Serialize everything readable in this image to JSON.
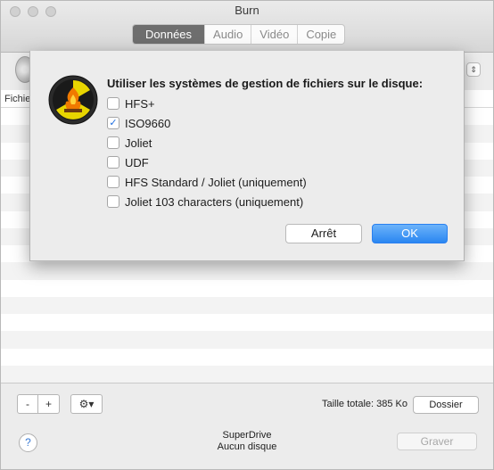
{
  "window": {
    "title": "Burn"
  },
  "tabs": [
    {
      "label": "Données",
      "active": true
    },
    {
      "label": "Audio",
      "active": false
    },
    {
      "label": "Vidéo",
      "active": false
    },
    {
      "label": "Copie",
      "active": false
    }
  ],
  "file_list": {
    "column_header": "Fichie"
  },
  "toolbar": {
    "minus_label": "-",
    "plus_label": "+",
    "gear_icon": "gear-icon",
    "total_label": "Taille totale: 385 Ko",
    "folder_button": "Dossier"
  },
  "drive": {
    "name": "SuperDrive",
    "status": "Aucun disque"
  },
  "burn_button": {
    "label": "Graver",
    "enabled": false
  },
  "help_label": "?",
  "sheet": {
    "title": "Utiliser les systèmes de gestion de fichiers sur le disque:",
    "options": [
      {
        "label": "HFS+",
        "checked": false
      },
      {
        "label": "ISO9660",
        "checked": true
      },
      {
        "label": "Joliet",
        "checked": false
      },
      {
        "label": "UDF",
        "checked": false
      },
      {
        "label": "HFS Standard / Joliet (uniquement)",
        "checked": false
      },
      {
        "label": "Joliet 103 characters (uniquement)",
        "checked": false
      }
    ],
    "cancel_label": "Arrêt",
    "ok_label": "OK"
  },
  "colors": {
    "accent": "#2a86f1",
    "tab_active": "#6e6e6e"
  }
}
